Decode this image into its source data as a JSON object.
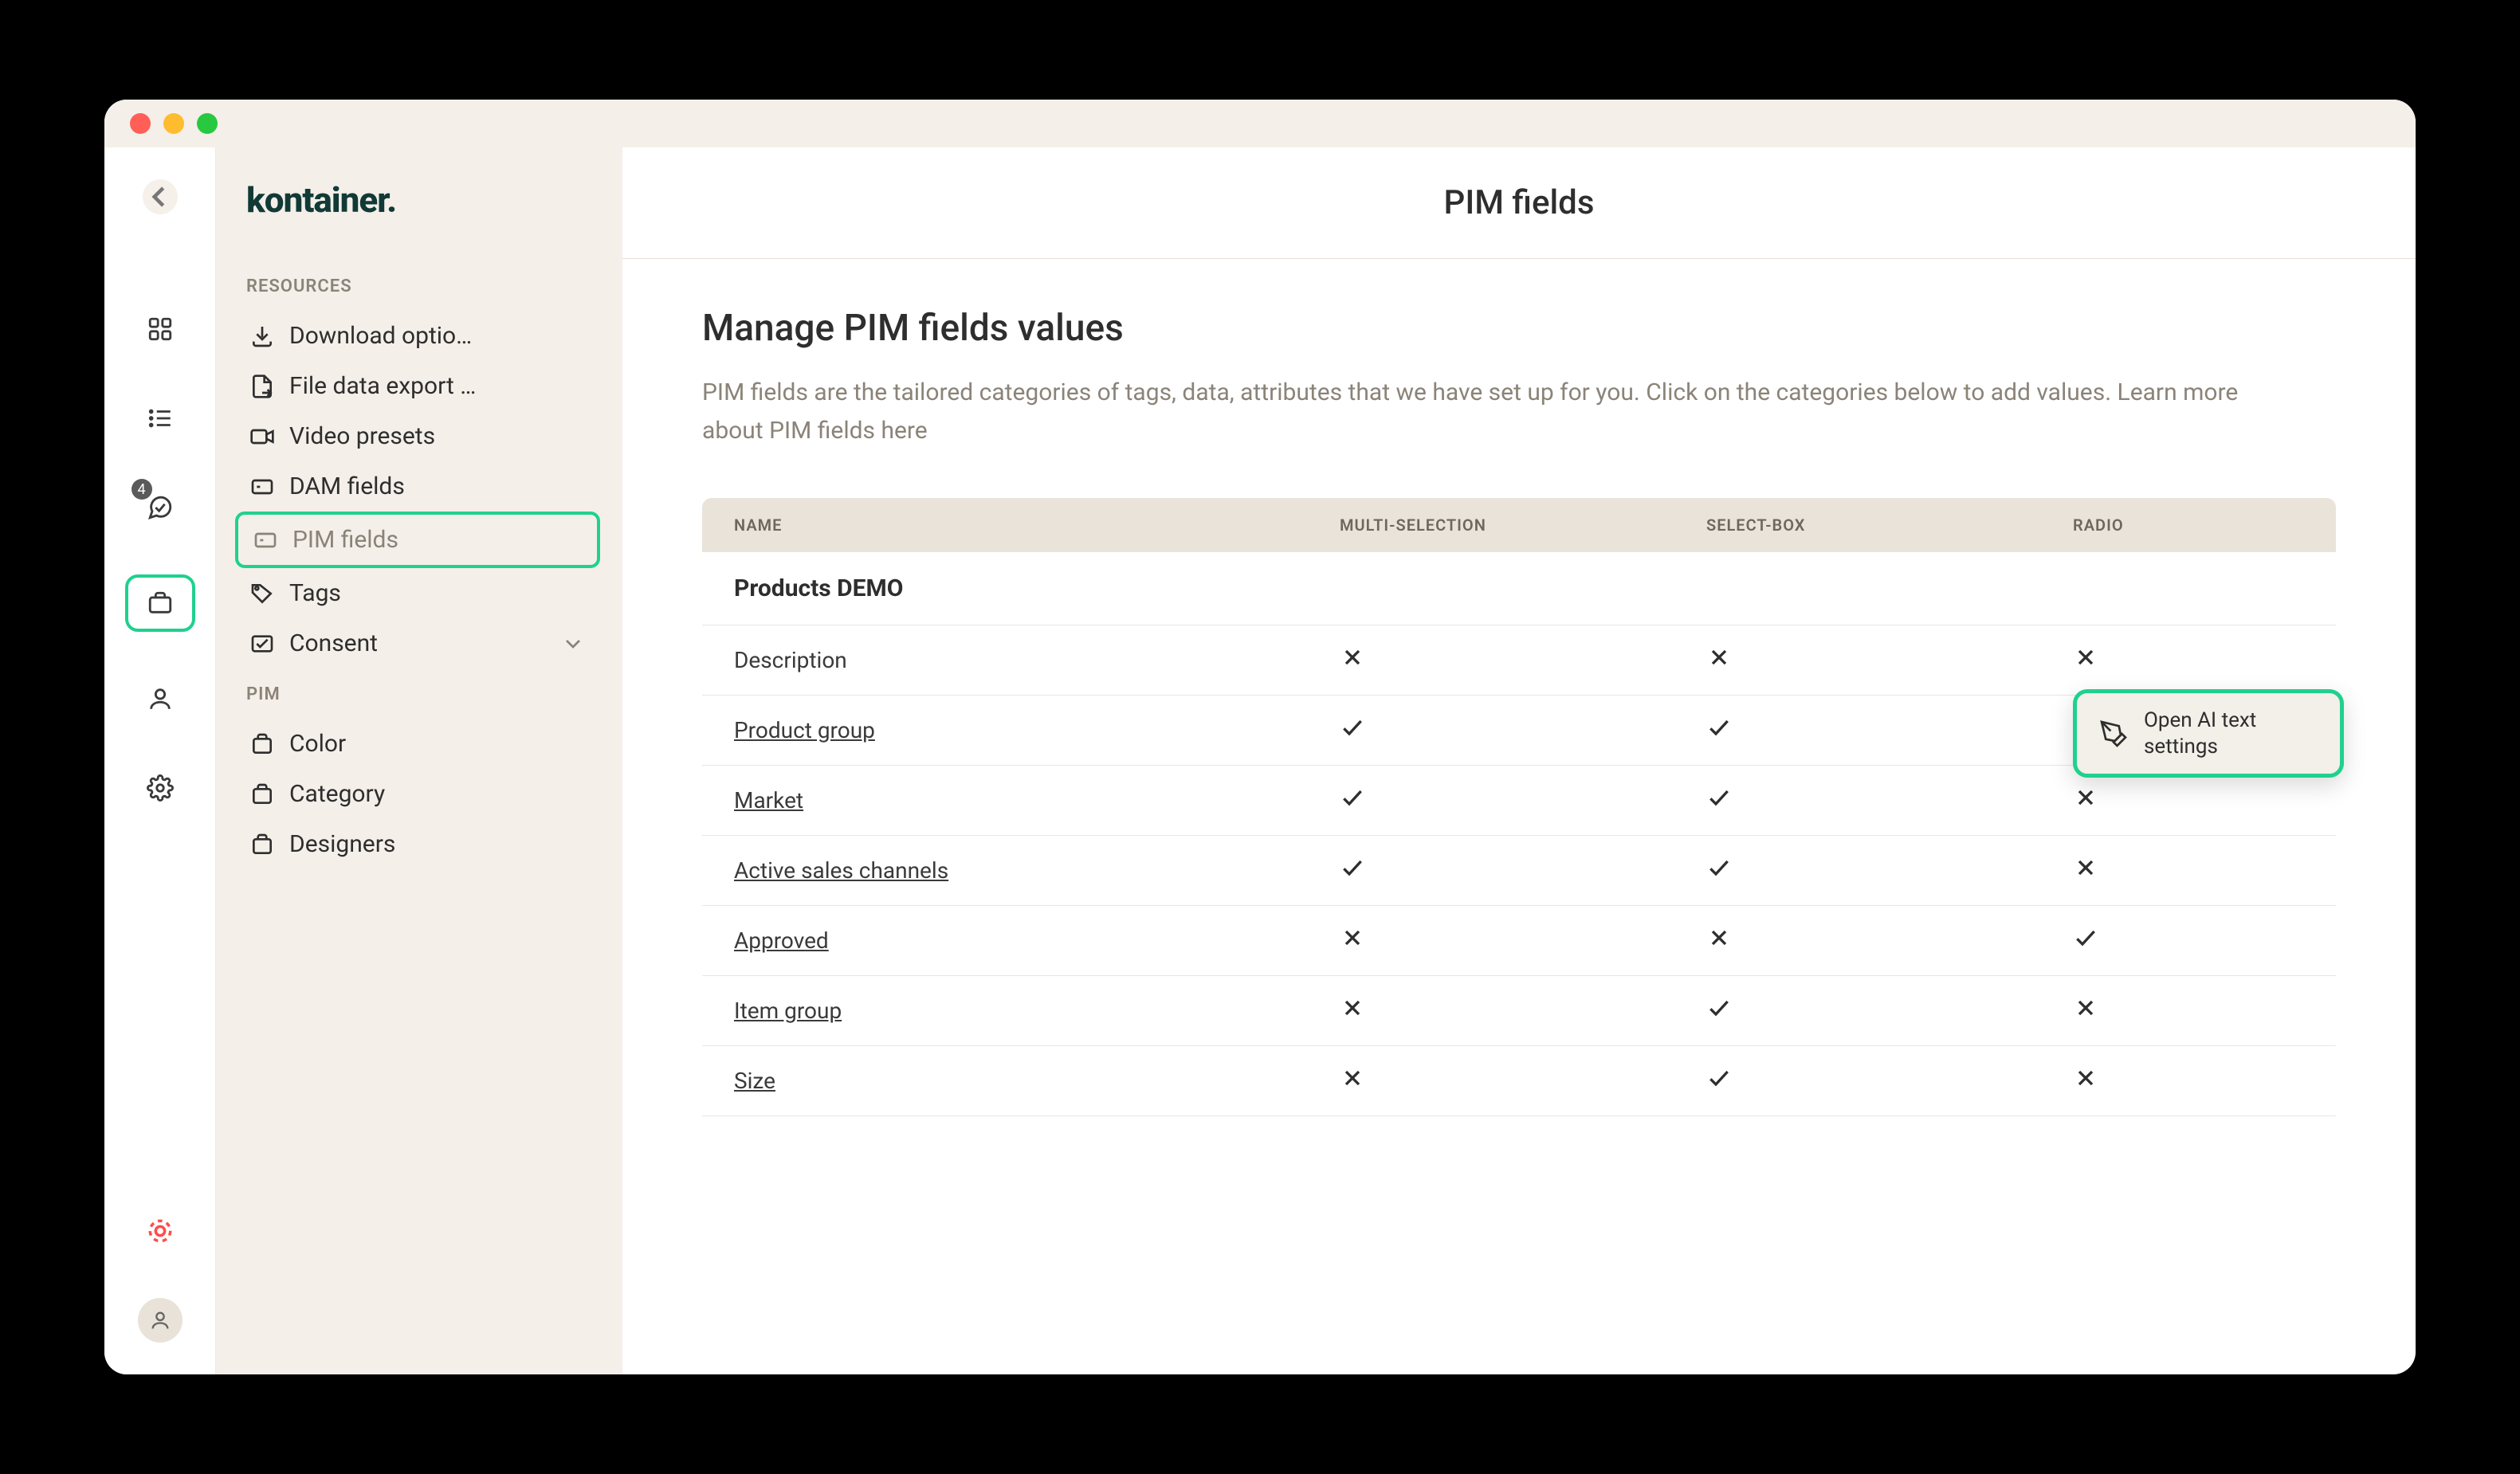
{
  "rail": {
    "notification_count": "4"
  },
  "sidebar": {
    "logo": "kontainer.",
    "sections": [
      {
        "label": "RESOURCES",
        "items": [
          {
            "label": "Download optio…"
          },
          {
            "label": "File data export …"
          },
          {
            "label": "Video presets"
          },
          {
            "label": "DAM fields"
          },
          {
            "label": "PIM fields",
            "active": true
          },
          {
            "label": "Tags"
          },
          {
            "label": "Consent",
            "expandable": true
          }
        ]
      },
      {
        "label": "PIM",
        "items": [
          {
            "label": "Color"
          },
          {
            "label": "Category"
          },
          {
            "label": "Designers"
          }
        ]
      }
    ]
  },
  "header": {
    "title": "PIM fields"
  },
  "page": {
    "heading": "Manage PIM fields values",
    "description_pre": "PIM fields are the tailored categories of tags, data, attributes that we have set up for you. Click on the categories below to add values. Learn more about PIM fields ",
    "description_link": "here"
  },
  "table": {
    "columns": {
      "name": "NAME",
      "multi": "MULTI-SELECTION",
      "select": "SELECT-BOX",
      "radio": "RADIO"
    },
    "group": "Products DEMO",
    "rows": [
      {
        "name": "Description",
        "underline": false,
        "multi": "x",
        "select": "x",
        "radio": "x",
        "actions": false
      },
      {
        "name": "Product group",
        "underline": true,
        "multi": "check",
        "select": "check",
        "radio": "x",
        "actions": false
      },
      {
        "name": "Market",
        "underline": true,
        "multi": "check",
        "select": "check",
        "radio": "x",
        "actions": true
      },
      {
        "name": "Active sales channels",
        "underline": true,
        "multi": "check",
        "select": "check",
        "radio": "x",
        "actions": true
      },
      {
        "name": "Approved",
        "underline": true,
        "multi": "x",
        "select": "x",
        "radio": "check",
        "actions": true
      },
      {
        "name": "Item group",
        "underline": true,
        "multi": "x",
        "select": "check",
        "radio": "x",
        "actions": true
      },
      {
        "name": "Size",
        "underline": true,
        "multi": "x",
        "select": "check",
        "radio": "x",
        "actions": true
      }
    ]
  },
  "popover": {
    "line1": "Open AI text",
    "line2": "settings"
  }
}
